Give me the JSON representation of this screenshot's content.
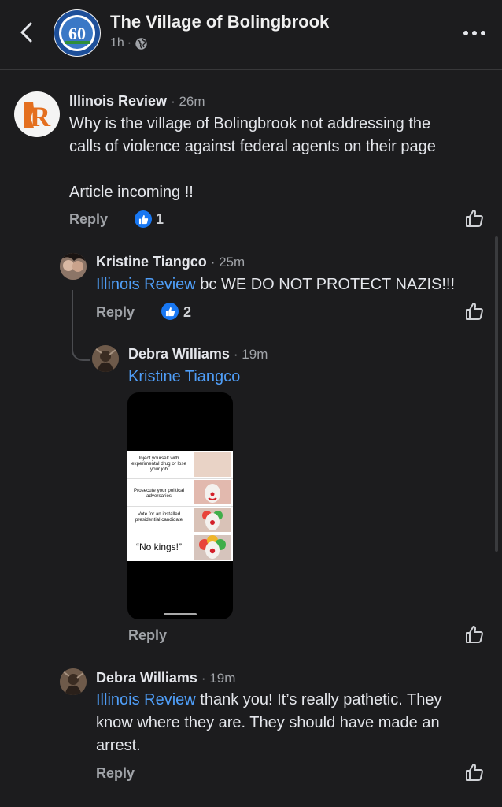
{
  "header": {
    "title": "The Village of Bolingbrook",
    "time": "1h",
    "separator": "·"
  },
  "comments": [
    {
      "author": "Illinois Review",
      "time": "· 26m",
      "text_line1": "Why is the village of Bolingbrook not addressing the",
      "text_line2": "calls of violence against federal agents on their page",
      "text_line3": "Article incoming !!",
      "reply_label": "Reply",
      "likes": "1"
    },
    {
      "author": "Kristine Tiangco",
      "time": "· 25m",
      "mention": "Illinois Review",
      "text": " bc WE DO NOT PROTECT NAZIS!!!",
      "reply_label": "Reply",
      "likes": "2"
    },
    {
      "author": "Debra Williams",
      "time": "· 19m",
      "mention": "Kristine Tiangco",
      "reply_label": "Reply",
      "meme": {
        "row1": "Inject yourself with experimental drug or lose your job",
        "row2": "Prosecute your political adversaries",
        "row3": "Vote for an installed presidential candidate",
        "row4": "“No kings!”"
      }
    },
    {
      "author": "Debra Williams",
      "time": "· 19m",
      "mention": "Illinois Review",
      "text_line1_rest": " thank you!  It’s really pathetic. They",
      "text_line2": "know where they are. They should have made an",
      "text_line3": "arrest.",
      "reply_label": "Reply"
    }
  ],
  "icons": {
    "back": "back-chevron-icon",
    "globe": "globe-icon",
    "more": "more-icon",
    "like": "thumbs-up-icon"
  },
  "colors": {
    "background": "#1c1c1e",
    "mention": "#4f9ef8",
    "like_badge": "#1877f2"
  }
}
